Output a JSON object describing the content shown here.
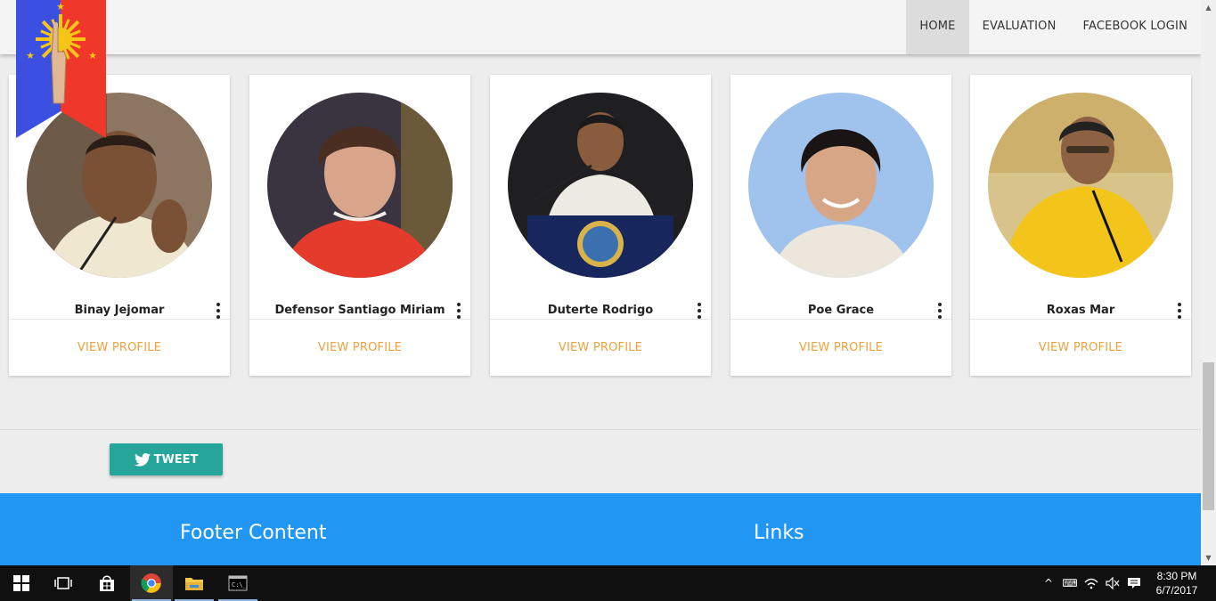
{
  "nav": {
    "items": [
      {
        "label": "HOME",
        "active": true
      },
      {
        "label": "EVALUATION",
        "active": false
      },
      {
        "label": "FACEBOOK LOGIN",
        "active": false
      }
    ]
  },
  "candidates": [
    {
      "name": "Binay Jejomar",
      "action": "VIEW PROFILE"
    },
    {
      "name": "Defensor Santiago Miriam",
      "action": "VIEW PROFILE"
    },
    {
      "name": "Duterte Rodrigo",
      "action": "VIEW PROFILE"
    },
    {
      "name": "Poe Grace",
      "action": "VIEW PROFILE"
    },
    {
      "name": "Roxas Mar",
      "action": "VIEW PROFILE"
    }
  ],
  "tweet": {
    "label": "TWEET"
  },
  "footer": {
    "content_title": "Footer Content",
    "links_title": "Links"
  },
  "taskbar": {
    "time": "8:30 PM",
    "date": "6/7/2017"
  },
  "colors": {
    "accent_orange": "#f0a13c",
    "tweet_teal": "#26a69a",
    "footer_blue": "#2196f3"
  }
}
